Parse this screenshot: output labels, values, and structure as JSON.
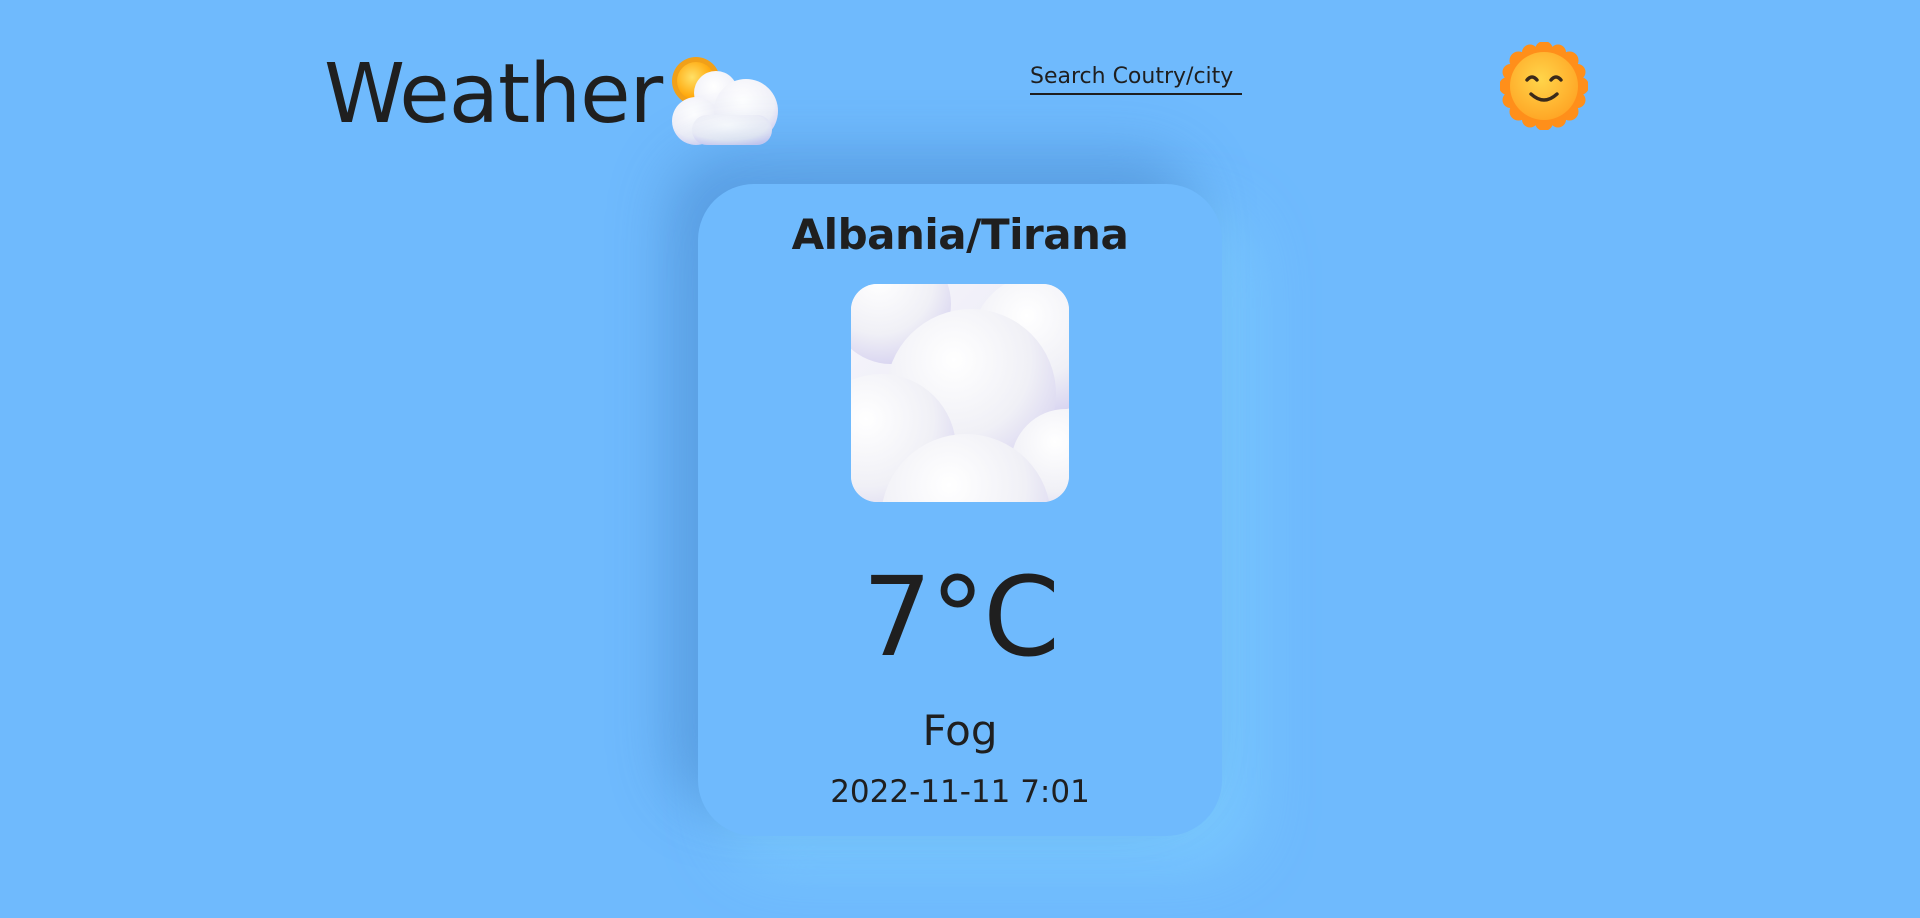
{
  "header": {
    "app_title": "Weather",
    "logo_icon": "sun-behind-cloud-icon",
    "search": {
      "value": "",
      "placeholder": "Search Coutry/city"
    },
    "avatar_icon": "smiling-sun-icon"
  },
  "weather_card": {
    "location": "Albania/Tirana",
    "condition_icon": "fog-clouds-icon",
    "temperature": "7°C",
    "condition": "Fog",
    "timestamp": "2022-11-11 7:01"
  },
  "colors": {
    "background": "#6fbafd",
    "text": "#1f1f1f",
    "sun": "#ffb300",
    "cloud": "#f4f4fb"
  }
}
